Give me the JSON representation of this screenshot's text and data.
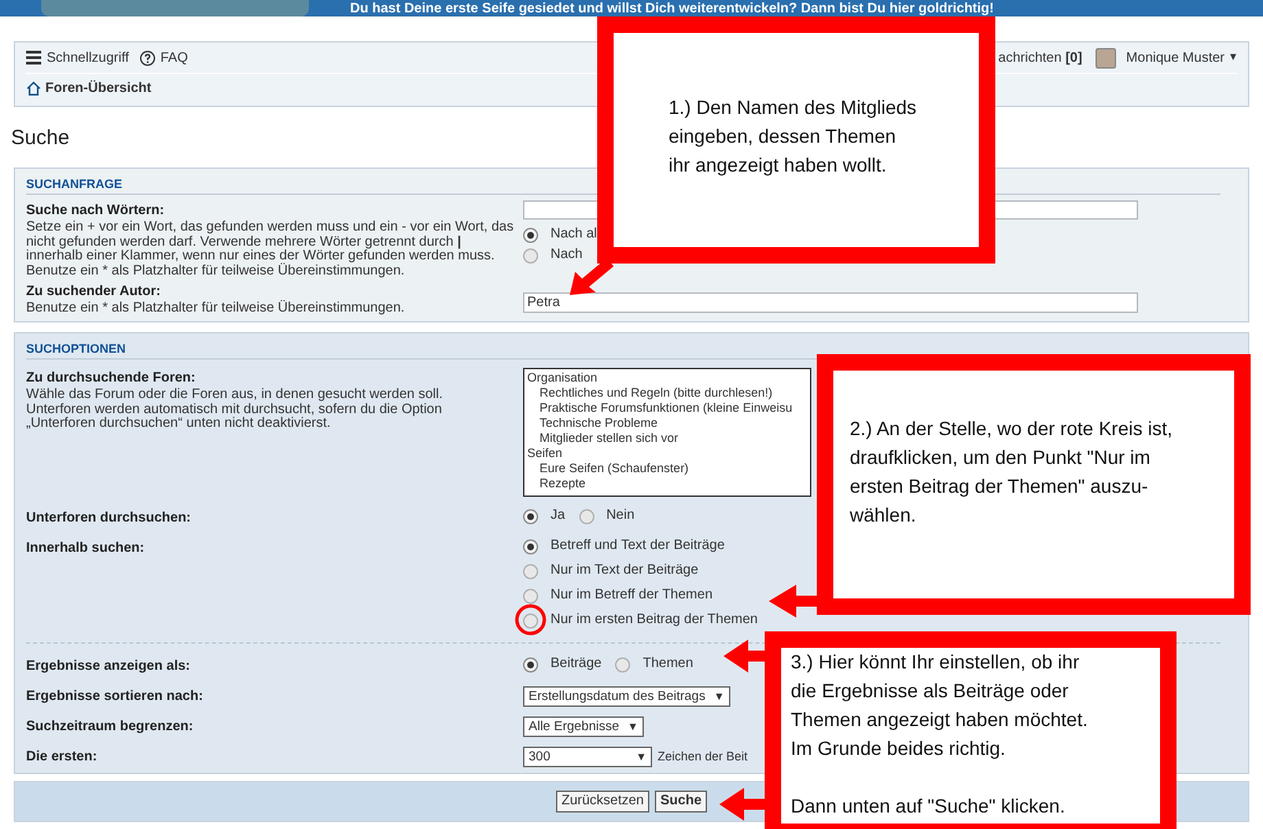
{
  "banner": {
    "text": "Du hast Deine erste Seife gesiedet und willst Dich weiterentwickeln? Dann bist Du hier goldrichtig!"
  },
  "navbar": {
    "quick_access": "Schnellzugriff",
    "faq": "FAQ",
    "messages": "achrichten **[0]**",
    "user": "Monique Muster",
    "caret": "▾"
  },
  "breadcrumb": "Foren-Übersicht",
  "page_title": "Suche",
  "search_query": {
    "heading": "SUCHANFRAGE",
    "words_label": "Suche nach Wörtern:",
    "words_help": "Setze ein + vor ein Wort, das gefunden werden muss und ein - vor ein Wort, das nicht gefunden werden darf. Verwende mehrere Wörter getrennt durch **|** innerhalb einer Klammer, wenn nur eines der Wörter gefunden werden muss. Benutze ein * als Platzhalter für teilweise Übereinstimmungen.",
    "word_modes": [
      {
        "label": "Nach al",
        "selected": true
      },
      {
        "label": "Nach",
        "selected": false
      }
    ],
    "author_label": "Zu suchender Autor:",
    "author_help": "Benutze ein * als Platzhalter für teilweise Übereinstimmungen.",
    "author_value": "Petra"
  },
  "search_options": {
    "heading": "SUCHOPTIONEN",
    "forums_label": "Zu durchsuchende Foren:",
    "forums_help": "Wähle das Forum oder die Foren aus, in denen gesucht werden soll. Unterforen werden automatisch mit durchsucht, sofern du die Option „Unterforen durchsuchen“ unten nicht deaktivierst.",
    "forums": [
      {
        "label": "Organisation",
        "children": [
          {
            "label": "Rechtliches und Regeln (bitte durchlesen!)"
          },
          {
            "label": "Praktische Forumsfunktionen (kleine Einweisu"
          },
          {
            "label": "Technische Probleme"
          },
          {
            "label": "Mitglieder stellen sich vor"
          }
        ]
      },
      {
        "label": "Seifen",
        "children": [
          {
            "label": "Eure Seifen (Schaufenster)"
          },
          {
            "label": "Rezepte"
          }
        ]
      }
    ],
    "subforums_label": "Unterforen durchsuchen:",
    "subforums": [
      {
        "label": "Ja",
        "selected": true
      },
      {
        "label": "Nein",
        "selected": false
      }
    ],
    "within_label": "Innerhalb suchen:",
    "within": [
      {
        "label": "Betreff und Text der Beiträge",
        "selected": true
      },
      {
        "label": "Nur im Text der Beiträge",
        "selected": false
      },
      {
        "label": "Nur im Betreff der Themen",
        "selected": false
      },
      {
        "label": "Nur im ersten Beitrag der Themen",
        "selected": false
      }
    ],
    "results_label": "Ergebnisse anzeigen als:",
    "results_as": [
      {
        "label": "Beiträge",
        "selected": true
      },
      {
        "label": "Themen",
        "selected": false
      }
    ],
    "sort_label": "Ergebnisse sortieren nach:",
    "sort_value": "Erstellungsdatum des Beitrags",
    "sort_caret": "▼",
    "timespan_label": "Suchzeitraum begrenzen:",
    "timespan_value": "Alle Ergebnisse",
    "timespan_caret": "▼",
    "first_label": "Die ersten:",
    "first_value": "300",
    "first_caret": "▼",
    "first_suffix": "Zeichen der Beit"
  },
  "buttons": [
    "Zurücksetzen",
    "Suche"
  ],
  "annotations": [
    {
      "text": "1.) Den Namen des Mitglieds\neingeben, dessen Themen\nihr angezeigt haben wollt."
    },
    {
      "text": "2.) An der Stelle, wo der rote Kreis ist,\ndraufklicken, um den Punkt \"Nur im\nersten Beitrag der Themen\" auszu-\nwählen."
    },
    {
      "text": "3.) Hier könnt Ihr einstellen, ob ihr\ndie Ergebnisse als Beiträge oder\nThemen angezeigt haben möchtet.\nIm Grunde beides richtig.\n\nDann unten auf \"Suche\" klicken."
    }
  ]
}
